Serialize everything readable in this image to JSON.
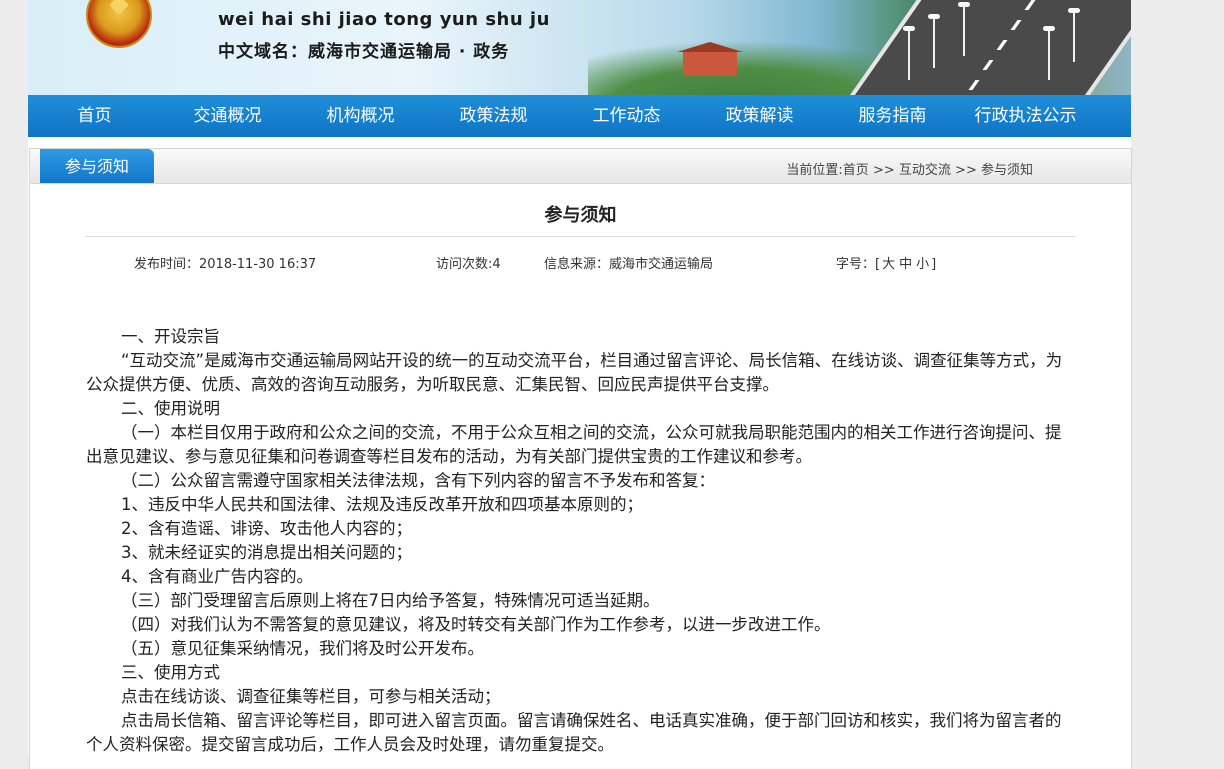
{
  "header": {
    "site_pinyin": "wei hai shi jiao tong yun shu ju",
    "site_cn": "中文域名：威海市交通运输局 · 政务"
  },
  "nav": {
    "items": [
      "首页",
      "交通概况",
      "机构概况",
      "政策法规",
      "工作动态",
      "政策解读",
      "服务指南",
      "行政执法公示"
    ]
  },
  "section": {
    "tab_label": "参与须知",
    "breadcrumb": [
      "当前位置:首页",
      ">>",
      "互动交流",
      ">>",
      "参与须知"
    ]
  },
  "article": {
    "title": "参与须知",
    "published": "发布时间：2018-11-30 16:37",
    "visits": "访问次数:4",
    "source": "信息来源：威海市交通运输局",
    "font_label": "字号：[",
    "font_large": "大",
    "font_medium": "中",
    "font_small": "小",
    "font_close": "]",
    "paragraphs": [
      "一、开设宗旨",
      "“互动交流”是威海市交通运输局网站开设的统一的互动交流平台，栏目通过留言评论、局长信箱、在线访谈、调查征集等方式，为公众提供方便、优质、高效的咨询互动服务，为听取民意、汇集民智、回应民声提供平台支撑。",
      "二、使用说明",
      "（一）本栏目仅用于政府和公众之间的交流，不用于公众互相之间的交流，公众可就我局职能范围内的相关工作进行咨询提问、提出意见建议、参与意见征集和问卷调查等栏目发布的活动，为有关部门提供宝贵的工作建议和参考。",
      "（二）公众留言需遵守国家相关法律法规，含有下列内容的留言不予发布和答复：",
      "1、违反中华人民共和国法律、法规及违反改革开放和四项基本原则的；",
      "2、含有造谣、诽谤、攻击他人内容的；",
      "3、就未经证实的消息提出相关问题的；",
      "4、含有商业广告内容的。",
      "（三）部门受理留言后原则上将在7日内给予答复，特殊情况可适当延期。",
      "（四）对我们认为不需答复的意见建议，将及时转交有关部门作为工作参考，以进一步改进工作。",
      "（五）意见征集采纳情况，我们将及时公开发布。",
      "三、使用方式",
      "点击在线访谈、调查征集等栏目，可参与相关活动；",
      "点击局长信箱、留言评论等栏目，即可进入留言页面。留言请确保姓名、电话真实准确，便于部门回访和核实，我们将为留言者的个人资料保密。提交留言成功后，工作人员会及时处理，请勿重复提交。"
    ]
  }
}
